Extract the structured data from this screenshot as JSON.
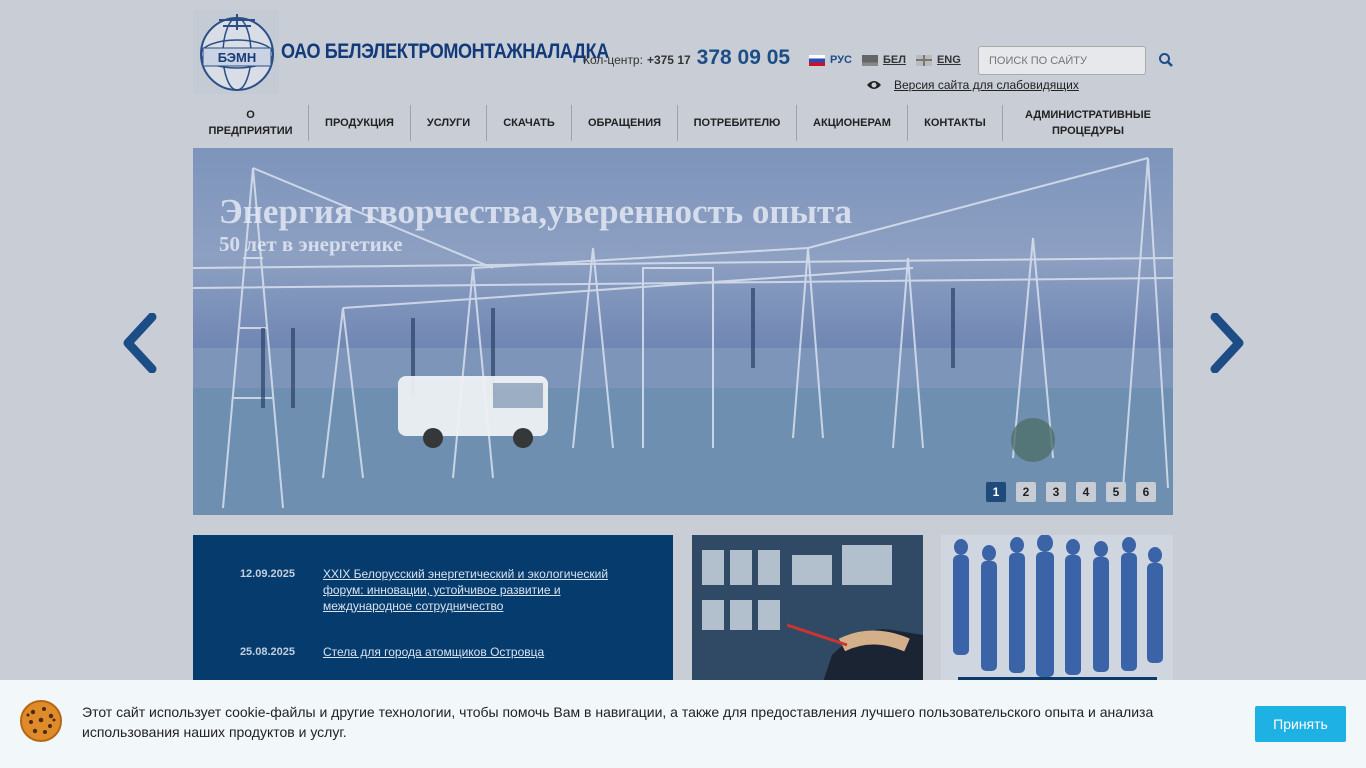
{
  "header": {
    "logo_text": "ОАО БЕЛЭЛЕКТРОМОНТАЖНАЛАДКА",
    "logo_emblem_text": "БЭМН",
    "callcenter_label": "Кол-центр:",
    "callcenter_code": "+375 17",
    "callcenter_number": "378 09 05",
    "languages": [
      {
        "label": "РУС",
        "flag": "ru"
      },
      {
        "label": "БЕЛ",
        "flag": "by"
      },
      {
        "label": "ENG",
        "flag": "en"
      }
    ],
    "search_placeholder": "ПОИСК ПО САЙТУ",
    "low_vision_label": "Версия сайта для слабовидящих"
  },
  "nav": {
    "items": [
      {
        "label": "О ПРЕДПРИЯТИИ"
      },
      {
        "label": "ПРОДУКЦИЯ"
      },
      {
        "label": "УСЛУГИ"
      },
      {
        "label": "СКАЧАТЬ"
      },
      {
        "label": "ОБРАЩЕНИЯ"
      },
      {
        "label": "ПОТРЕБИТЕЛЮ"
      },
      {
        "label": "АКЦИОНЕРАМ"
      },
      {
        "label": "КОНТАКТЫ"
      },
      {
        "label": "АДМИНИСТРАТИВНЫЕ ПРОЦЕДУРЫ"
      }
    ]
  },
  "slider": {
    "title": "Энергия творчества,уверенность опыта",
    "subtitle": "50 лет в энергетике",
    "pages": [
      "1",
      "2",
      "3",
      "4",
      "5",
      "6"
    ],
    "active_page": "1"
  },
  "news": [
    {
      "date": "12.09.2025",
      "title": "XXIX Белорусский энергетический и экологический форум: инновации, устойчивое развитие и международное сотрудничество"
    },
    {
      "date": "25.08.2025",
      "title": "Стела для города атомщиков Островца"
    }
  ],
  "cookie": {
    "text": "Этот сайт использует cookie-файлы и другие технологии, чтобы помочь Вам в навигации, а также для предоставления лучшего пользовательского опыта и анализа использования наших продуктов и услуг.",
    "accept_label": "Принять"
  },
  "colors": {
    "accent": "#1c4d86",
    "news_bg": "#053c6d",
    "cookie_button": "#1eb1e3"
  }
}
